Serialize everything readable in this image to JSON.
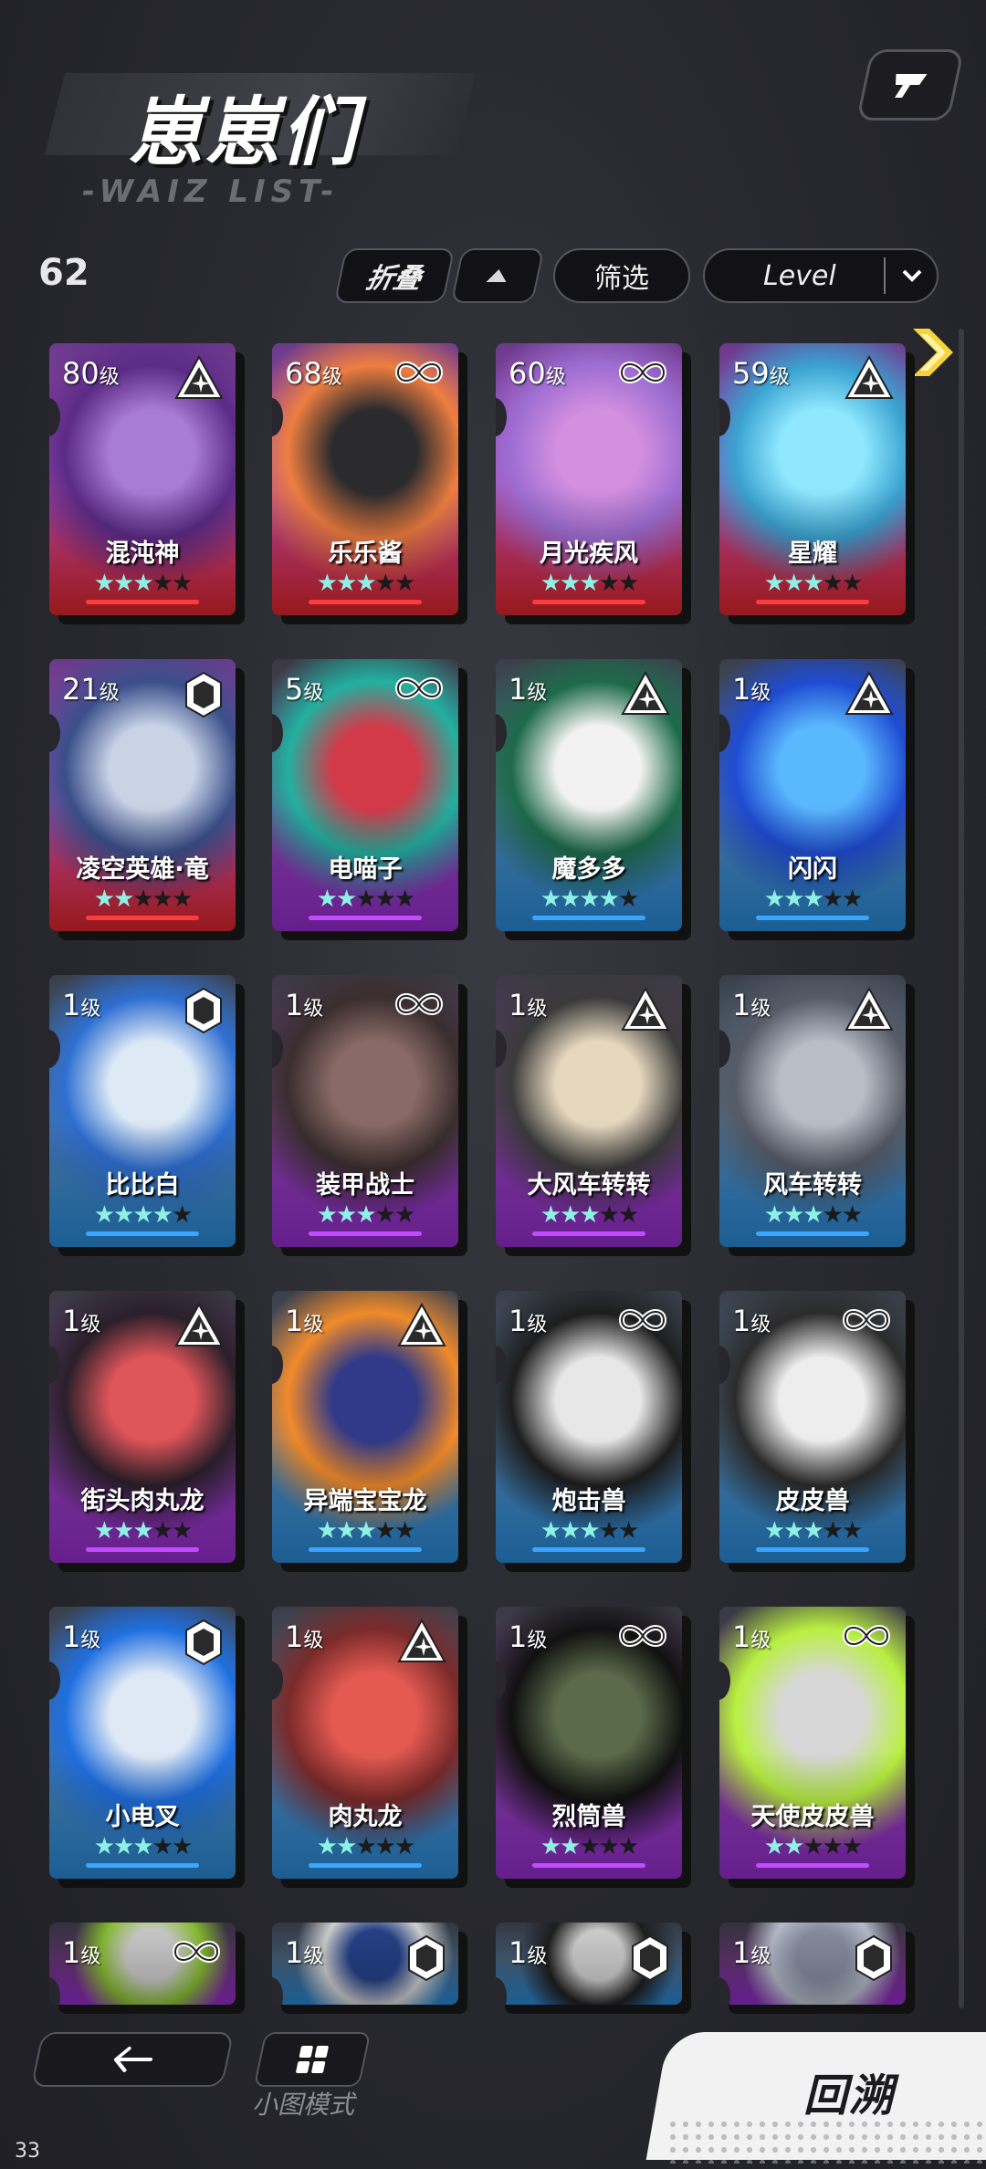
{
  "header": {
    "title": "崽崽们",
    "subtitle": "-WAIZ LIST-",
    "count": "62"
  },
  "toolbar": {
    "fold_label": "折叠",
    "filter_label": "筛选",
    "sort_value": "Level"
  },
  "colors": {
    "red": "#e5262d",
    "purple": "#9b2fd6",
    "blue": "#2b8fe0",
    "star_on": "#8ff0e6",
    "arrow": "#f5d33a"
  },
  "cards": [
    {
      "level": "80",
      "unit": "级",
      "name": "混沌神",
      "rarity": "red",
      "badge": "triangle-star-icon",
      "stars": [
        1,
        1,
        1,
        0,
        0
      ]
    },
    {
      "level": "68",
      "unit": "级",
      "name": "乐乐酱",
      "rarity": "red",
      "badge": "infinity-icon",
      "stars": [
        1,
        1,
        1,
        0,
        0
      ]
    },
    {
      "level": "60",
      "unit": "级",
      "name": "月光疾风",
      "rarity": "red",
      "badge": "infinity-icon",
      "stars": [
        1,
        1,
        1,
        0,
        0
      ]
    },
    {
      "level": "59",
      "unit": "级",
      "name": "星耀",
      "rarity": "red",
      "badge": "triangle-star-icon",
      "stars": [
        1,
        1,
        1,
        0,
        0
      ]
    },
    {
      "level": "21",
      "unit": "级",
      "name": "凌空英雄·竜",
      "rarity": "red",
      "badge": "hexagon-icon",
      "stars": [
        1,
        1,
        0,
        0,
        0
      ]
    },
    {
      "level": "5",
      "unit": "级",
      "name": "电喵子",
      "rarity": "purple",
      "badge": "infinity-icon",
      "stars": [
        1,
        1,
        0,
        0,
        0
      ]
    },
    {
      "level": "1",
      "unit": "级",
      "name": "魔多多",
      "rarity": "blue",
      "badge": "triangle-star-icon",
      "stars": [
        1,
        1,
        1,
        1,
        0
      ]
    },
    {
      "level": "1",
      "unit": "级",
      "name": "闪闪",
      "rarity": "blue",
      "badge": "triangle-star-icon",
      "stars": [
        1,
        1,
        1,
        0,
        0
      ]
    },
    {
      "level": "1",
      "unit": "级",
      "name": "比比白",
      "rarity": "blue",
      "badge": "hexagon-icon",
      "stars": [
        1,
        1,
        1,
        1,
        0
      ]
    },
    {
      "level": "1",
      "unit": "级",
      "name": "装甲战士",
      "rarity": "purple",
      "badge": "infinity-icon",
      "stars": [
        1,
        1,
        1,
        0,
        0
      ]
    },
    {
      "level": "1",
      "unit": "级",
      "name": "大风车转转",
      "rarity": "purple",
      "badge": "triangle-star-icon",
      "stars": [
        1,
        1,
        1,
        0,
        0
      ]
    },
    {
      "level": "1",
      "unit": "级",
      "name": "风车转转",
      "rarity": "blue",
      "badge": "triangle-star-icon",
      "stars": [
        1,
        1,
        1,
        0,
        0
      ]
    },
    {
      "level": "1",
      "unit": "级",
      "name": "街头肉丸龙",
      "rarity": "purple",
      "badge": "triangle-star-icon",
      "stars": [
        1,
        1,
        1,
        0,
        0
      ]
    },
    {
      "level": "1",
      "unit": "级",
      "name": "异端宝宝龙",
      "rarity": "blue",
      "badge": "triangle-star-icon",
      "stars": [
        1,
        1,
        1,
        0,
        0
      ]
    },
    {
      "level": "1",
      "unit": "级",
      "name": "炮击兽",
      "rarity": "blue",
      "badge": "infinity-icon",
      "stars": [
        1,
        1,
        1,
        0,
        0
      ]
    },
    {
      "level": "1",
      "unit": "级",
      "name": "皮皮兽",
      "rarity": "blue",
      "badge": "infinity-icon",
      "stars": [
        1,
        1,
        1,
        0,
        0
      ]
    },
    {
      "level": "1",
      "unit": "级",
      "name": "小电叉",
      "rarity": "blue",
      "badge": "hexagon-icon",
      "stars": [
        1,
        1,
        1,
        0,
        0
      ]
    },
    {
      "level": "1",
      "unit": "级",
      "name": "肉丸龙",
      "rarity": "blue",
      "badge": "triangle-star-icon",
      "stars": [
        1,
        1,
        0,
        0,
        0
      ]
    },
    {
      "level": "1",
      "unit": "级",
      "name": "烈筒兽",
      "rarity": "purple",
      "badge": "infinity-icon",
      "stars": [
        1,
        1,
        0,
        0,
        0
      ]
    },
    {
      "level": "1",
      "unit": "级",
      "name": "天使皮皮兽",
      "rarity": "purple",
      "badge": "infinity-icon",
      "stars": [
        1,
        1,
        0,
        0,
        0
      ]
    },
    {
      "level": "1",
      "unit": "级",
      "name": "",
      "rarity": "purple",
      "badge": "infinity-icon",
      "stars": []
    },
    {
      "level": "1",
      "unit": "级",
      "name": "",
      "rarity": "blue",
      "badge": "hexagon-icon",
      "stars": []
    },
    {
      "level": "1",
      "unit": "级",
      "name": "",
      "rarity": "blue",
      "badge": "hexagon-icon",
      "stars": []
    },
    {
      "level": "1",
      "unit": "级",
      "name": "",
      "rarity": "purple",
      "badge": "hexagon-icon",
      "stars": []
    }
  ],
  "bottom": {
    "mode_label": "小图模式",
    "retro_label": "回溯",
    "page_number": "33"
  }
}
